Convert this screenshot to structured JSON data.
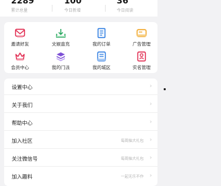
{
  "stats": [
    {
      "value": "2289",
      "label": "累计总量"
    },
    {
      "value": "100",
      "label": "今日新增"
    },
    {
      "value": "36",
      "label": "今日阅读"
    }
  ],
  "grid": [
    {
      "label": "邀请好友",
      "icon": "invite-envelope-icon",
      "color": "#e0284e"
    },
    {
      "label": "文娱直充",
      "icon": "download-tray-icon",
      "color": "#22a55a"
    },
    {
      "label": "我的订单",
      "icon": "order-document-icon",
      "color": "#2f7de1"
    },
    {
      "label": "广告管理",
      "icon": "ad-card-icon",
      "color": "#f0a21d"
    },
    {
      "label": "会员中心",
      "icon": "vip-crown-icon",
      "color": "#e0284e"
    },
    {
      "label": "我的门派",
      "icon": "stack-layers-icon",
      "color": "#7d4fd6"
    },
    {
      "label": "我的城区",
      "icon": "city-book-icon",
      "color": "#2f7de1"
    },
    {
      "label": "实名管理",
      "icon": "id-card-icon",
      "color": "#e0284e"
    }
  ],
  "menu": [
    {
      "label": "设置中心",
      "desc": ""
    },
    {
      "label": "关于我们",
      "desc": ""
    },
    {
      "label": "帮助中心",
      "desc": ""
    },
    {
      "label": "加入社区",
      "desc": "每周抽大礼包"
    },
    {
      "label": "关注微信号",
      "desc": "每周抽大礼包"
    },
    {
      "label": "加入趣料",
      "desc": "一起无乐不作"
    }
  ]
}
